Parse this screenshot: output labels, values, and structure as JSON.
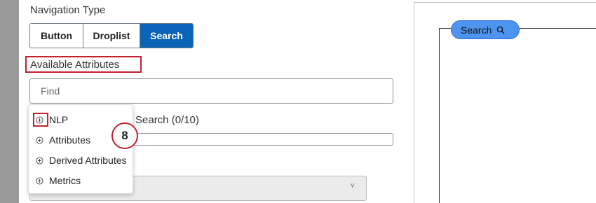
{
  "navigation_type": {
    "label": "Navigation Type",
    "options": [
      "Button",
      "Droplist",
      "Search"
    ],
    "selected": "Search"
  },
  "available_attributes": {
    "label": "Available Attributes",
    "find_placeholder": "Find",
    "dropdown_items": [
      {
        "label": "NLP",
        "icon": "plus-circle-icon"
      },
      {
        "label": "Attributes",
        "icon": "plus-circle-icon"
      },
      {
        "label": "Derived Attributes",
        "icon": "plus-circle-icon"
      },
      {
        "label": "Metrics",
        "icon": "plus-circle-icon"
      }
    ]
  },
  "search_count_label": "Search (0/10)",
  "step_number": "8",
  "preview": {
    "search_button_label": "Search",
    "search_icon": "magnifier-icon"
  },
  "colors": {
    "accent_blue": "#0a63b6",
    "highlight_red": "#c4212e",
    "preview_blue": "#4d94f0"
  }
}
